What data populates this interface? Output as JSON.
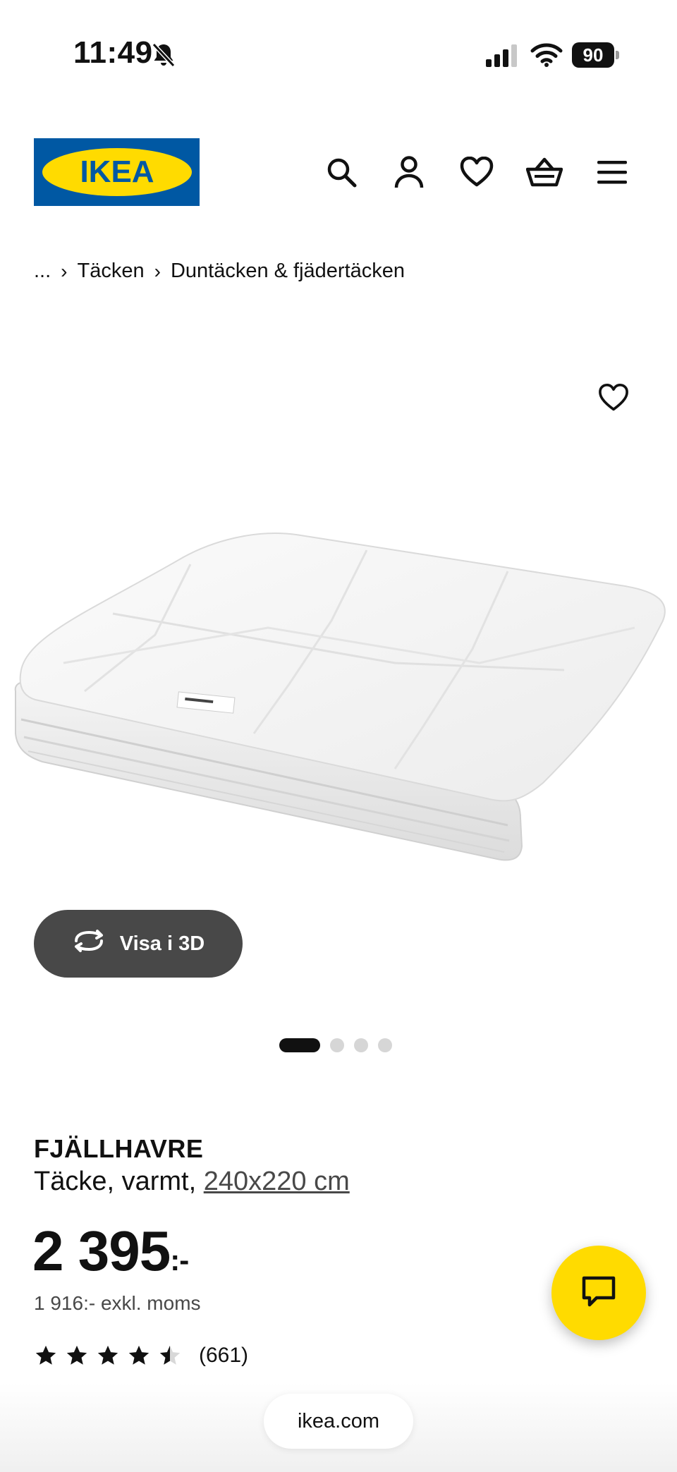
{
  "status_bar": {
    "time": "11:49",
    "battery": "90"
  },
  "header": {
    "logo_text": "IKEA",
    "brand_colors": {
      "blue": "#0058A3",
      "yellow": "#FFDB00"
    },
    "icons": [
      "search-icon",
      "account-icon",
      "heart-icon",
      "cart-icon",
      "menu-icon"
    ]
  },
  "breadcrumb": {
    "ellipsis": "...",
    "items": [
      "Täcken",
      "Duntäcken & fjädertäcken"
    ]
  },
  "product": {
    "view3d_label": "Visa i 3D",
    "image_count": 4,
    "active_image": 1,
    "name": "FJÄLLHAVRE",
    "description_prefix": "Täcke, varmt, ",
    "size_link": "240x220 cm",
    "price_main": "2 395",
    "price_suffix": ":-",
    "price_ex_vat": "1 916:- exkl. moms",
    "rating": 4.5,
    "review_count": "(661)"
  },
  "browser": {
    "url": "ikea.com"
  }
}
